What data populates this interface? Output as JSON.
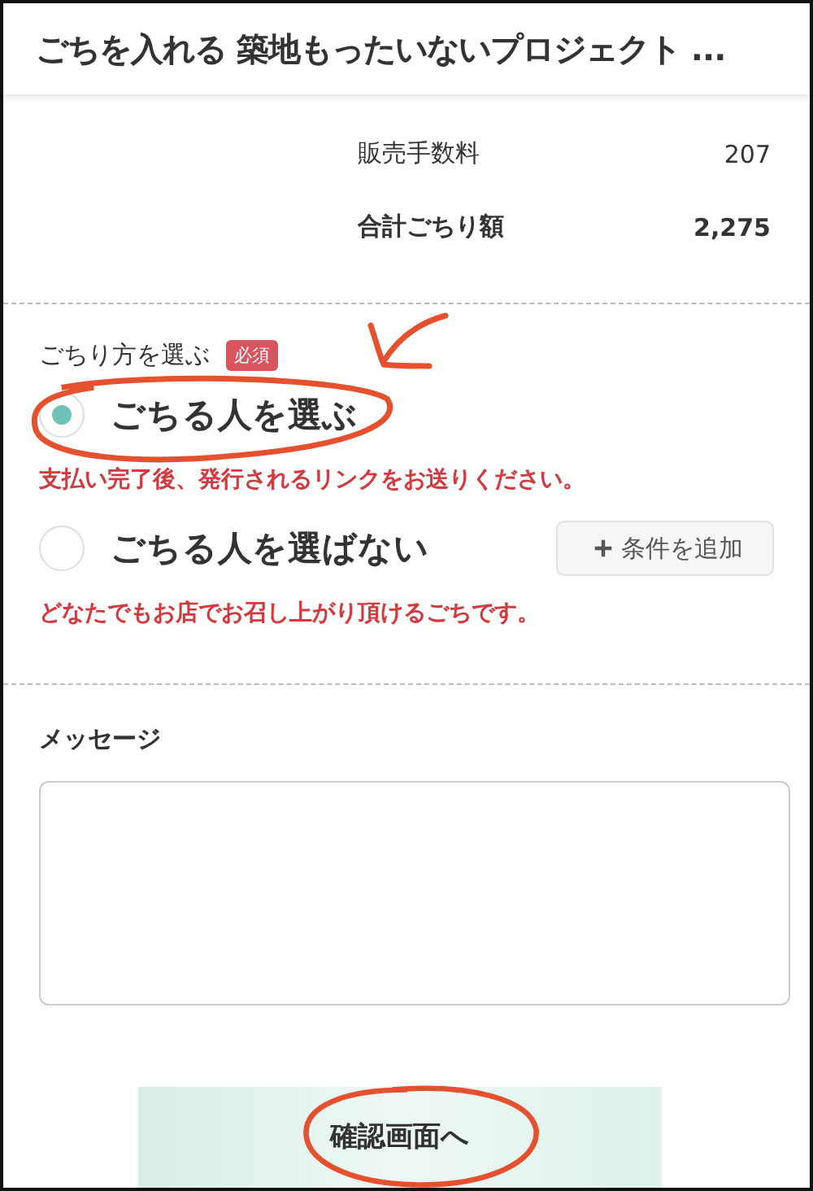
{
  "header": {
    "title": "ごちを入れる 築地もったいないプロジェクト ..."
  },
  "summary": [
    {
      "kind": "fee",
      "label": "販売手数料",
      "value": "207"
    },
    {
      "kind": "total",
      "label": "合計ごちり額",
      "value": "2,275"
    }
  ],
  "method": {
    "label": "ごちり方を選ぶ",
    "badge": "必須",
    "options": [
      {
        "label": "ごちる人を選ぶ",
        "selected": true,
        "note": "支払い完了後、発行されるリンクをお送りください。"
      },
      {
        "label": "ごちる人を選ばない",
        "selected": false,
        "action": "条件を追加",
        "note": "どなたでもお店でお召し上がり頂けるごちです。"
      }
    ]
  },
  "message": {
    "label": "メッセージ"
  },
  "submit": {
    "label": "確認画面へ"
  }
}
